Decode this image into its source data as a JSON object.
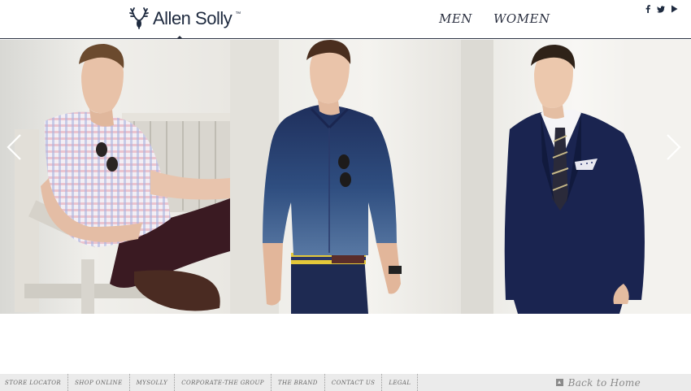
{
  "brand": {
    "name": "Allen Solly",
    "trademark": "™"
  },
  "nav": {
    "items": [
      {
        "label": "MEN"
      },
      {
        "label": "WOMEN"
      }
    ]
  },
  "social": {
    "icons": [
      "facebook-icon",
      "twitter-icon",
      "youtube-icon"
    ]
  },
  "slider": {
    "panels": [
      {
        "name": "model-gingham-shirt"
      },
      {
        "name": "model-denim-shirt"
      },
      {
        "name": "model-navy-suit"
      }
    ]
  },
  "footer": {
    "links": [
      {
        "label": "STORE LOCATOR"
      },
      {
        "label": "SHOP ONLINE"
      },
      {
        "label": "MYSOLLY"
      },
      {
        "label": "CORPORATE-THE GROUP"
      },
      {
        "label": "THE BRAND"
      },
      {
        "label": "CONTACT US"
      },
      {
        "label": "LEGAL"
      }
    ],
    "back_home": "Back to Home"
  },
  "colors": {
    "brand_navy": "#1e2a3f",
    "footer_bg": "#ebebeb"
  }
}
